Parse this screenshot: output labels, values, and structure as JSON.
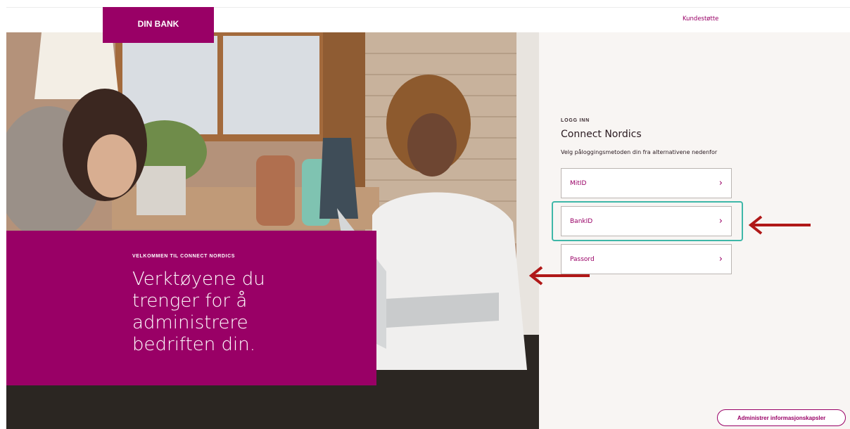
{
  "header": {
    "logo_text": "DIN BANK",
    "support_link": "Kundestøtte"
  },
  "hero": {
    "kicker": "VELKOMMEN TIL CONNECT NORDICS",
    "headline_lines": [
      "Verktøyene du",
      "trenger for å",
      "administrere",
      "bedriften din."
    ]
  },
  "login": {
    "kicker": "LOGG INN",
    "title": "Connect Nordics",
    "subtitle": "Velg påloggingsmetoden din fra alternativene nedenfor",
    "methods": [
      {
        "label": "MitID",
        "chevron": "›"
      },
      {
        "label": "BankID",
        "chevron": "›"
      },
      {
        "label": "Passord",
        "chevron": "›"
      }
    ]
  },
  "footer": {
    "cookie_button": "Administrer informasjonskapsler"
  },
  "colors": {
    "brand": "#990066",
    "highlight": "#3fb7a8",
    "annotation_arrow": "#b01818"
  }
}
